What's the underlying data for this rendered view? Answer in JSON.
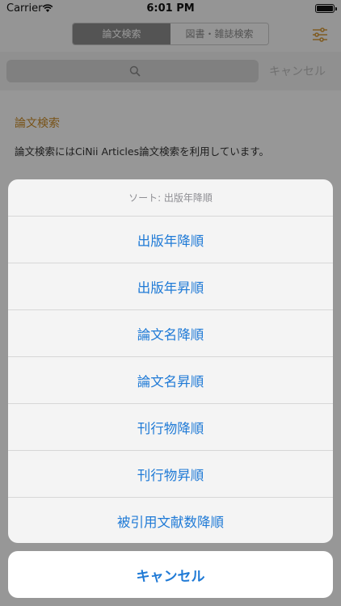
{
  "status_bar": {
    "carrier": "Carrier",
    "time": "6:01 PM"
  },
  "nav": {
    "segments": [
      "論文検索",
      "図書・雑誌検索"
    ],
    "selected_segment": "論文検索"
  },
  "search": {
    "placeholder": "",
    "cancel_label": "キャンセル"
  },
  "content": {
    "section_title": "論文検索",
    "section_text": "論文検索にはCiNii Articles論文検索を利用しています。"
  },
  "action_sheet": {
    "header": "ソート: 出版年降順",
    "options": [
      "出版年降順",
      "出版年昇順",
      "論文名降順",
      "論文名昇順",
      "刊行物降順",
      "刊行物昇順",
      "被引用文献数降順"
    ],
    "cancel_label": "キャンセル"
  },
  "colors": {
    "accent": "#1f7ad6",
    "section_title": "#c98b28",
    "segment_selected": "#8c8c8c"
  },
  "icons": [
    "wifi-icon",
    "battery-icon",
    "filter-icon",
    "search-icon"
  ]
}
